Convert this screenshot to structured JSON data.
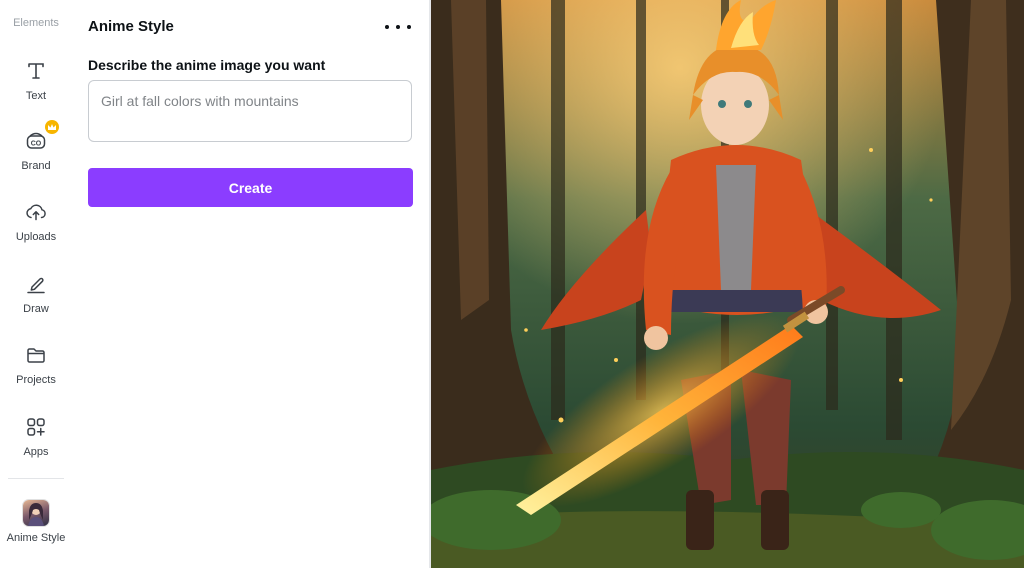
{
  "rail": {
    "top_label": "Elements",
    "items": [
      {
        "label": "Text",
        "icon": "text-icon"
      },
      {
        "label": "Brand",
        "icon": "brand-icon",
        "badge": "crown-icon"
      },
      {
        "label": "Uploads",
        "icon": "upload-cloud-icon"
      },
      {
        "label": "Draw",
        "icon": "pen-icon"
      },
      {
        "label": "Projects",
        "icon": "folder-icon"
      },
      {
        "label": "Apps",
        "icon": "apps-grid-icon"
      },
      {
        "label": "Anime Style",
        "icon": "anime-style-app-thumbnail"
      }
    ]
  },
  "panel": {
    "title": "Anime Style",
    "prompt_label": "Describe the anime image you want",
    "prompt_placeholder": "Girl at fall colors with mountains",
    "prompt_value": "",
    "create_label": "Create"
  },
  "canvas": {
    "image": "anime-boy-flaming-sword-forest",
    "colors": {
      "accent": "#8b3dff",
      "crown": "#f7b500"
    }
  }
}
